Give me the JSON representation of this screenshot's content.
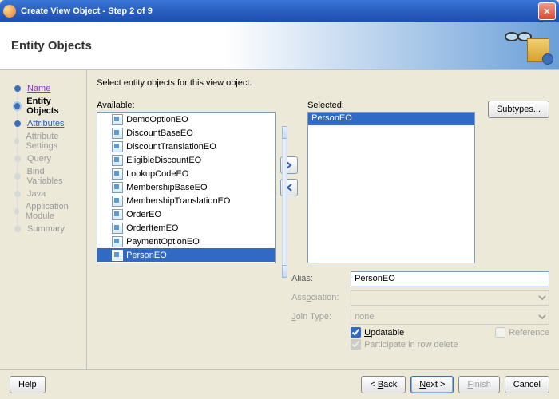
{
  "title": "Create View Object - Step 2 of 9",
  "header": "Entity Objects",
  "instruction": "Select entity objects for this view object.",
  "steps": [
    {
      "label": "Name",
      "state": "visited",
      "link": true
    },
    {
      "label": "Entity Objects",
      "state": "current",
      "link": false
    },
    {
      "label": "Attributes",
      "state": "visited",
      "link": true
    },
    {
      "label": "Attribute Settings",
      "state": "disabled",
      "link": false
    },
    {
      "label": "Query",
      "state": "disabled",
      "link": false
    },
    {
      "label": "Bind Variables",
      "state": "disabled",
      "link": false
    },
    {
      "label": "Java",
      "state": "disabled",
      "link": false
    },
    {
      "label": "Application Module",
      "state": "disabled",
      "link": false
    },
    {
      "label": "Summary",
      "state": "disabled",
      "link": false
    }
  ],
  "labels": {
    "available": "Available:",
    "selected": "Selected:",
    "subtypes": "Subtypes...",
    "alias": "Alias:",
    "association": "Association:",
    "join_type": "Join Type:",
    "updatable": "Updatable",
    "reference": "Reference",
    "participate": "Participate in row delete"
  },
  "available_items": [
    "DemoOptionEO",
    "DiscountBaseEO",
    "DiscountTranslationEO",
    "EligibleDiscountEO",
    "LookupCodeEO",
    "MembershipBaseEO",
    "MembershipTranslationEO",
    "OrderEO",
    "OrderItemEO",
    "PaymentOptionEO",
    "PersonEO"
  ],
  "available_selected_index": 10,
  "selected_items": [
    "PersonEO"
  ],
  "form": {
    "alias": "PersonEO",
    "association": "",
    "join_type": "none",
    "updatable": true,
    "reference": false,
    "participate": true
  },
  "buttons": {
    "help": "Help",
    "back": "< Back",
    "next": "Next >",
    "finish": "Finish",
    "cancel": "Cancel"
  }
}
